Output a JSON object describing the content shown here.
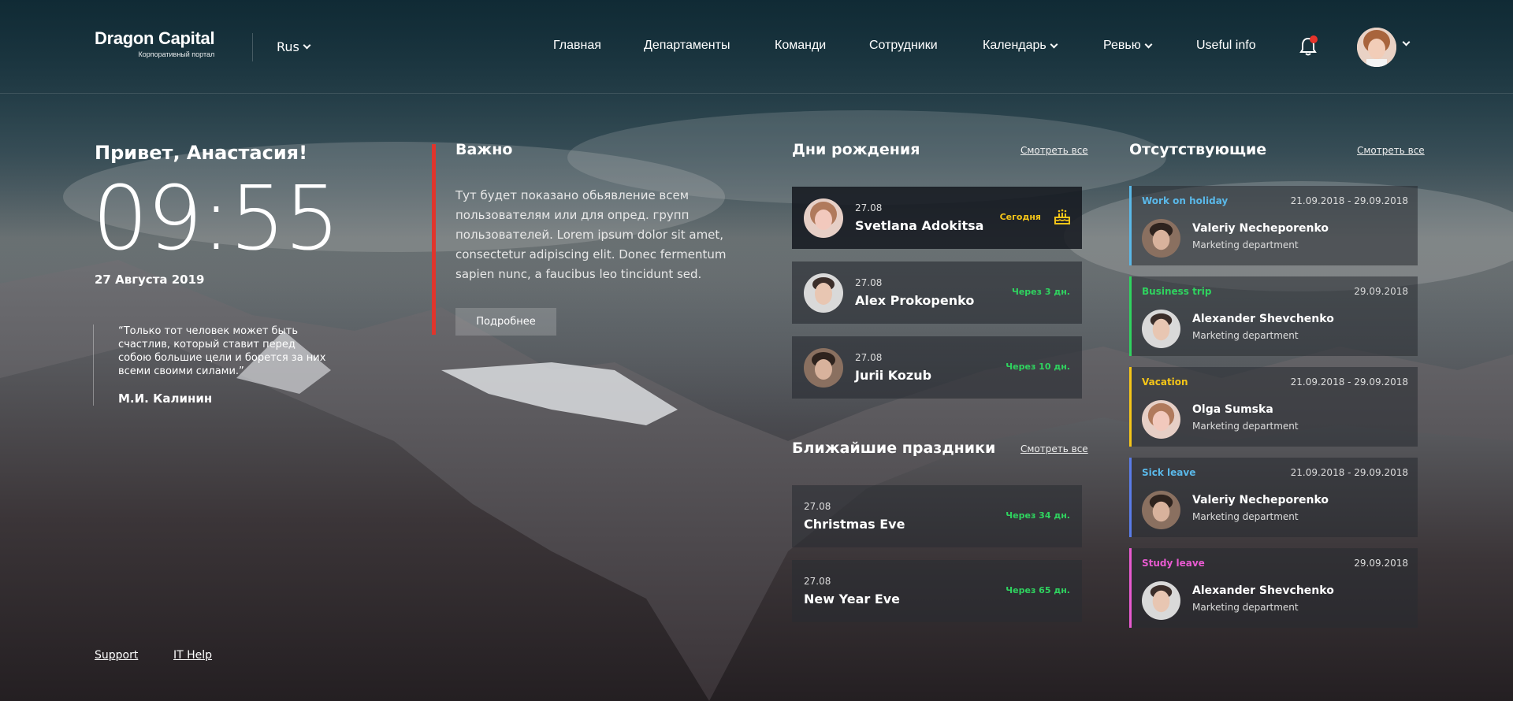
{
  "header": {
    "logo_main": "Dragon Capital",
    "logo_sub": "Корпоративный портал",
    "language": "Rus",
    "nav": [
      "Главная",
      "Департаменты",
      "Команди",
      "Сотрудники",
      "Календарь",
      "Ревью",
      "Useful info"
    ]
  },
  "greeting": "Привет, Анастасия!",
  "clock": "09:55",
  "date": "27 Августа 2019",
  "quote": {
    "text": "“Только тот человек может быть счастлив, который ставит перед собою большие цели и борется за них всеми своими силами.”",
    "author": "М.И. Калинин"
  },
  "important": {
    "title": "Важно",
    "text": "Тут будет показано обьявление всем пользователям или для опред. групп пользователей. Lorem ipsum dolor sit amet, consectetur adipiscing elit. Donec fermentum sapien nunc, a faucibus leo tincidunt sed.",
    "button": "Подробнее"
  },
  "birthdays": {
    "title": "Дни рождения",
    "see_all": "Смотреть все",
    "items": [
      {
        "date": "27.08",
        "name": "Svetlana Adokitsa",
        "status": "Сегодня"
      },
      {
        "date": "27.08",
        "name": "Alex Prokopenko",
        "status": "Через 3 дн."
      },
      {
        "date": "27.08",
        "name": "Jurii Kozub",
        "status": "Через 10 дн."
      }
    ]
  },
  "holidays": {
    "title": "Ближайшие праздники",
    "see_all": "Смотреть все",
    "items": [
      {
        "date": "27.08",
        "name": "Christmas Eve",
        "status": "Через 34 дн."
      },
      {
        "date": "27.08",
        "name": "New Year Eve",
        "status": "Через 65 дн."
      }
    ]
  },
  "absent": {
    "title": "Отсутствующие",
    "see_all": "Смотреть все",
    "items": [
      {
        "type": "Work on holiday",
        "dates": "21.09.2018 - 29.09.2018",
        "name": "Valeriy Necheporenko",
        "dept": "Marketing department",
        "color": "#5ab8e8"
      },
      {
        "type": "Business trip",
        "dates": "29.09.2018",
        "name": "Alexander Shevchenko",
        "dept": "Marketing department",
        "color": "#2fd35f"
      },
      {
        "type": "Vacation",
        "dates": "21.09.2018 - 29.09.2018",
        "name": "Olga Sumska",
        "dept": "Marketing department",
        "color": "#f5c518"
      },
      {
        "type": "Sick leave",
        "dates": "21.09.2018 - 29.09.2018",
        "name": "Valeriy Necheporenko",
        "dept": "Marketing department",
        "color": "#5a7ce8"
      },
      {
        "type": "Study leave",
        "dates": "29.09.2018",
        "name": "Alexander Shevchenko",
        "dept": "Marketing department",
        "color": "#e85ad0"
      }
    ]
  },
  "footer": {
    "links": [
      "Support",
      "IT Help"
    ]
  }
}
